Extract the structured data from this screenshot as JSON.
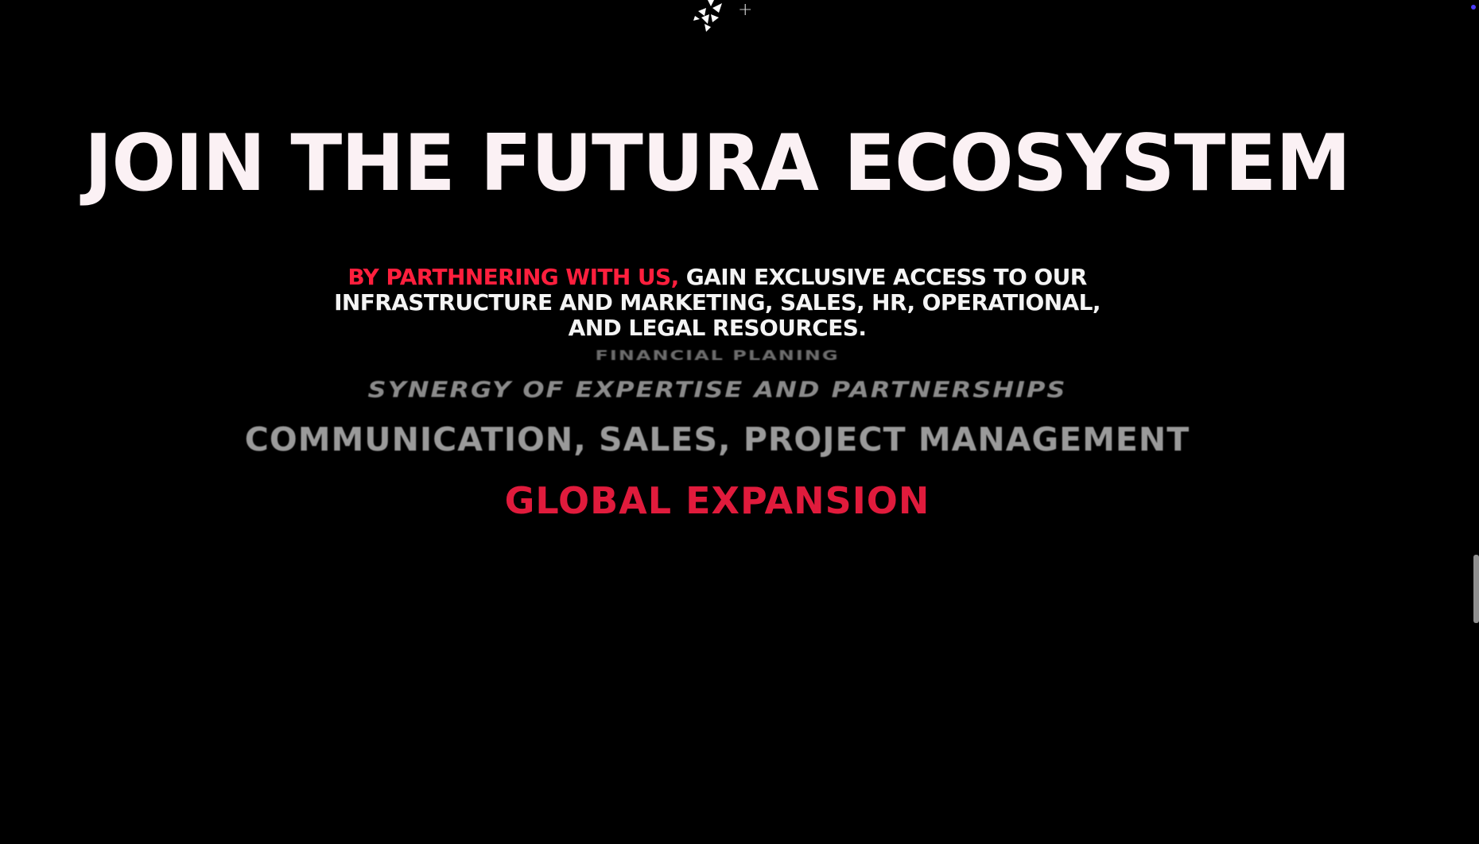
{
  "logo": {
    "icon": "snowflake-logo-icon"
  },
  "cursor": {
    "glyph": "+"
  },
  "headline": "JOIN THE FUTURA ECOSYSTEM",
  "intro": {
    "accent": "BY PARTHNERING WITH US,",
    "body": " GAIN EXCLUSIVE ACCESS TO OUR INFRASTRUCTURE AND MARKETING, SALES, HR, OPERATIONAL, AND LEGAL RESOURCES."
  },
  "ticker": [
    "FINANCIAL PLANING",
    "SYNERGY OF EXPERTISE AND PARTNERSHIPS",
    "COMMUNICATION, SALES, PROJECT MANAGEMENT",
    "GLOBAL EXPANSION"
  ],
  "colors": {
    "background": "#000000",
    "accent": "#ff1f3d",
    "active_item": "#e01b3c",
    "headline": "#fbf1f4"
  }
}
